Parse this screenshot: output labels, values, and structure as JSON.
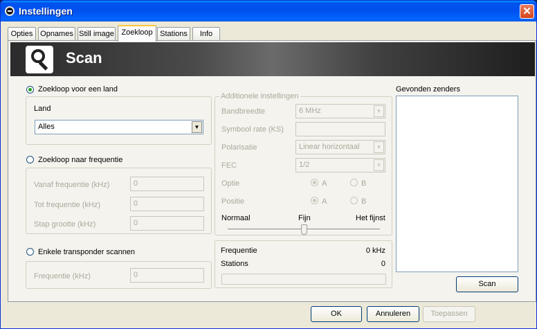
{
  "window": {
    "title": "Instellingen",
    "close_symbol": "✕"
  },
  "tabs": [
    "Opties",
    "Opnames",
    "Still image",
    "Zoekloop",
    "Stations",
    "Info"
  ],
  "banner": {
    "title": "Scan",
    "icon": "magnifier-icon"
  },
  "scan_country": {
    "label": "Zoekloop voor een land",
    "selected": true,
    "land_label": "Land",
    "land_value": "Alles"
  },
  "scan_frequency": {
    "label": "Zoekloop naar frequentie",
    "selected": false,
    "fields": [
      {
        "label": "Vanaf frequentie (kHz)",
        "value": "0"
      },
      {
        "label": "Tot frequentie (kHz)",
        "value": "0"
      },
      {
        "label": "Stap grootte (kHz)",
        "value": "0"
      }
    ]
  },
  "scan_transponder": {
    "label": "Enkele transponder scannen",
    "selected": false,
    "field": {
      "label": "Frequentie (kHz)",
      "value": "0"
    }
  },
  "additional": {
    "legend": "Additionele instellingen",
    "bandwidth": {
      "label": "Bandbreedte",
      "value": "6 MHz"
    },
    "symbol_rate": {
      "label": "Symbool rate (KS)",
      "value": ""
    },
    "polarisation": {
      "label": "Polarisatie",
      "value": "Linear horizontaal"
    },
    "fec": {
      "label": "FEC",
      "value": "1/2"
    },
    "option": {
      "label": "Optie",
      "a": "A",
      "b": "B",
      "selected": "A"
    },
    "position": {
      "label": "Positie",
      "a": "A",
      "b": "B",
      "selected": "A"
    },
    "slider": {
      "left": "Normaal",
      "mid": "Fijn",
      "right": "Het fijnst",
      "value_fraction": 0.5
    }
  },
  "status": {
    "freq_label": "Frequentie",
    "freq_value": "0 kHz",
    "stations_label": "Stations",
    "stations_value": "0",
    "progress": 0
  },
  "found": {
    "label": "Gevonden zenders",
    "scan_button": "Scan"
  },
  "footer": {
    "ok": "OK",
    "cancel": "Annuleren",
    "apply": "Toepassen"
  },
  "colors": {
    "title_blue": "#0053ee",
    "dialog_bg": "#ece9d8",
    "active_tab_accent": "#ffc73c",
    "radio_dot": "#21a121"
  }
}
